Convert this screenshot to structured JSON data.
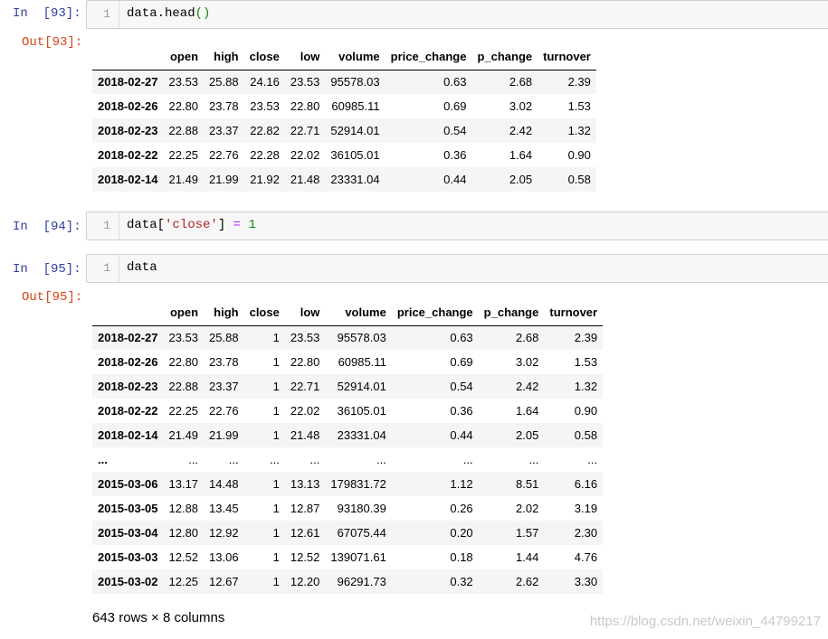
{
  "cells": {
    "c93": {
      "in_prompt": "In  [93]:",
      "line_no": "1",
      "code": {
        "head": "data.head",
        "paren": "()"
      },
      "out_prompt": "Out[93]:"
    },
    "c94": {
      "in_prompt": "In  [94]:",
      "line_no": "1",
      "code": {
        "a": "data[",
        "str": "'close'",
        "b": "] ",
        "op": "=",
        "sp": " ",
        "num": "1"
      }
    },
    "c95": {
      "in_prompt": "In  [95]:",
      "line_no": "1",
      "code": {
        "text": "data"
      },
      "out_prompt": "Out[95]:"
    }
  },
  "table1": {
    "columns": [
      "",
      "open",
      "high",
      "close",
      "low",
      "volume",
      "price_change",
      "p_change",
      "turnover"
    ],
    "rows": [
      [
        "2018-02-27",
        "23.53",
        "25.88",
        "24.16",
        "23.53",
        "95578.03",
        "0.63",
        "2.68",
        "2.39"
      ],
      [
        "2018-02-26",
        "22.80",
        "23.78",
        "23.53",
        "22.80",
        "60985.11",
        "0.69",
        "3.02",
        "1.53"
      ],
      [
        "2018-02-23",
        "22.88",
        "23.37",
        "22.82",
        "22.71",
        "52914.01",
        "0.54",
        "2.42",
        "1.32"
      ],
      [
        "2018-02-22",
        "22.25",
        "22.76",
        "22.28",
        "22.02",
        "36105.01",
        "0.36",
        "1.64",
        "0.90"
      ],
      [
        "2018-02-14",
        "21.49",
        "21.99",
        "21.92",
        "21.48",
        "23331.04",
        "0.44",
        "2.05",
        "0.58"
      ]
    ]
  },
  "table2": {
    "columns": [
      "",
      "open",
      "high",
      "close",
      "low",
      "volume",
      "price_change",
      "p_change",
      "turnover"
    ],
    "rows": [
      [
        "2018-02-27",
        "23.53",
        "25.88",
        "1",
        "23.53",
        "95578.03",
        "0.63",
        "2.68",
        "2.39"
      ],
      [
        "2018-02-26",
        "22.80",
        "23.78",
        "1",
        "22.80",
        "60985.11",
        "0.69",
        "3.02",
        "1.53"
      ],
      [
        "2018-02-23",
        "22.88",
        "23.37",
        "1",
        "22.71",
        "52914.01",
        "0.54",
        "2.42",
        "1.32"
      ],
      [
        "2018-02-22",
        "22.25",
        "22.76",
        "1",
        "22.02",
        "36105.01",
        "0.36",
        "1.64",
        "0.90"
      ],
      [
        "2018-02-14",
        "21.49",
        "21.99",
        "1",
        "21.48",
        "23331.04",
        "0.44",
        "2.05",
        "0.58"
      ],
      [
        "...",
        "...",
        "...",
        "...",
        "...",
        "...",
        "...",
        "...",
        "..."
      ],
      [
        "2015-03-06",
        "13.17",
        "14.48",
        "1",
        "13.13",
        "179831.72",
        "1.12",
        "8.51",
        "6.16"
      ],
      [
        "2015-03-05",
        "12.88",
        "13.45",
        "1",
        "12.87",
        "93180.39",
        "0.26",
        "2.02",
        "3.19"
      ],
      [
        "2015-03-04",
        "12.80",
        "12.92",
        "1",
        "12.61",
        "67075.44",
        "0.20",
        "1.57",
        "2.30"
      ],
      [
        "2015-03-03",
        "12.52",
        "13.06",
        "1",
        "12.52",
        "139071.61",
        "0.18",
        "1.44",
        "4.76"
      ],
      [
        "2015-03-02",
        "12.25",
        "12.67",
        "1",
        "12.20",
        "96291.73",
        "0.32",
        "2.62",
        "3.30"
      ]
    ],
    "summary": "643 rows × 8 columns"
  },
  "watermark": "https://blog.csdn.net/weixin_44799217",
  "colors": {
    "in_prompt": "#303f9f",
    "out_prompt": "#d84315",
    "string": "#ba2121",
    "number": "#0b8a0b",
    "operator": "#aa22ff"
  }
}
